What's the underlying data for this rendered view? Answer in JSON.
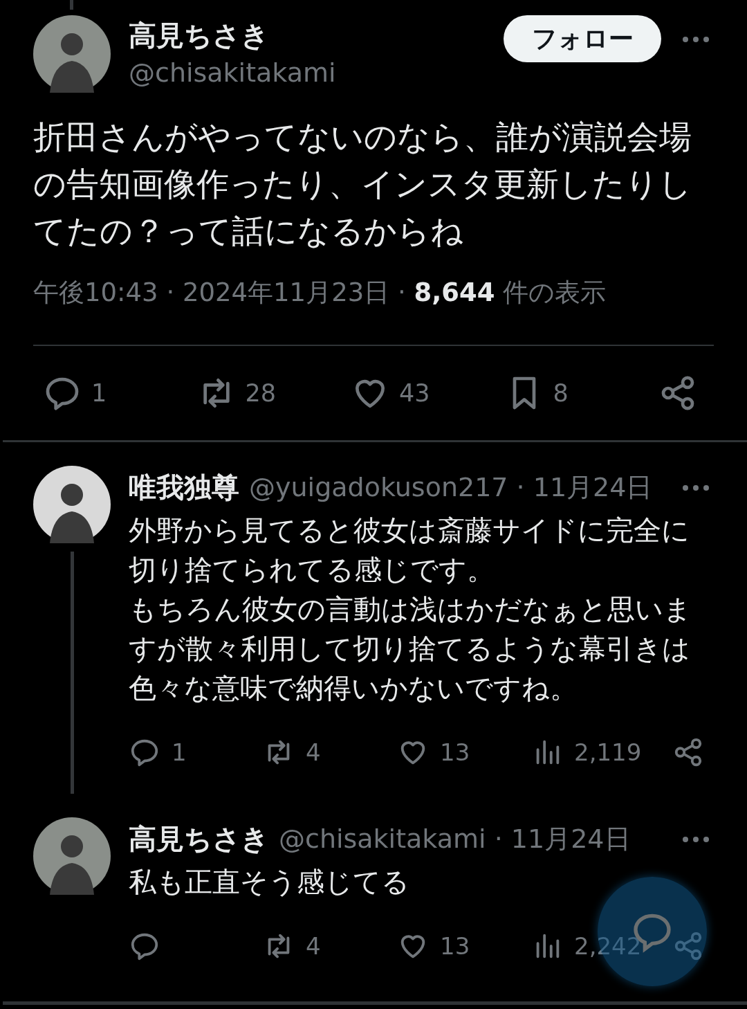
{
  "main_tweet": {
    "thread_above": true,
    "author": {
      "name": "高見ちさき",
      "handle": "@chisakitakami"
    },
    "follow_button": "フォロー",
    "text": "折田さんがやってないのなら、誰が演説会場の告知画像作ったり、インスタ更新したりしてたの？って話になるからね",
    "meta": "午後10:43 · 2024年11月23日 · **8,644** 件の表示",
    "actions": [
      {
        "kind": "reply",
        "count": "1"
      },
      {
        "kind": "repost",
        "count": "28"
      },
      {
        "kind": "like",
        "count": "43"
      },
      {
        "kind": "bookmark",
        "count": "8"
      },
      {
        "kind": "share"
      }
    ]
  },
  "replies": [
    {
      "name": "唯我独尊",
      "meta": "@yuigadokuson217 · 11月24日",
      "thread_line": true,
      "text": [
        "外野から見てると彼女は斎藤サイドに完全に切り捨てられてる感じです。",
        "もちろん彼女の言動は浅はかだなぁと思いますが散々利用して切り捨てるような幕引きは色々な意味で納得いかないですね。"
      ],
      "actions": [
        {
          "kind": "reply",
          "count": "1"
        },
        {
          "kind": "repost",
          "count": "4"
        },
        {
          "kind": "like",
          "count": "13"
        },
        {
          "kind": "views",
          "count": "2,119"
        },
        {
          "kind": "share"
        }
      ]
    },
    {
      "name": "高見ちさき",
      "meta": "@chisakitakami · 11月24日",
      "thread_line": false,
      "text": [
        "私も正直そう感じてる"
      ],
      "actions": [
        {
          "kind": "reply"
        },
        {
          "kind": "repost",
          "count": "4"
        },
        {
          "kind": "like",
          "count": "13"
        },
        {
          "kind": "views",
          "count": "2,242"
        },
        {
          "kind": "share"
        }
      ]
    }
  ]
}
